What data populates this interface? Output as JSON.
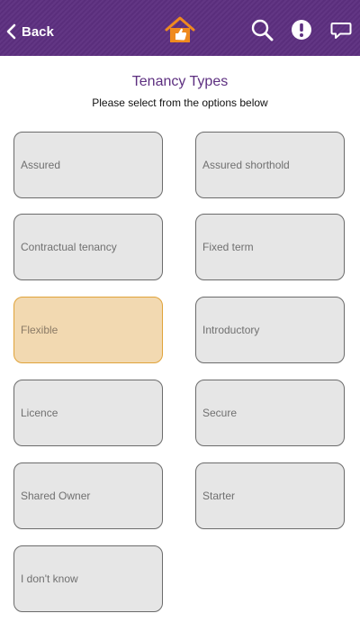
{
  "header": {
    "back_label": "Back",
    "accent_color": "#5d2f80",
    "home_icon_color": "#ef8a1f",
    "icons": [
      "chevron-left-icon",
      "house-thumbs-up-icon",
      "search-icon",
      "exclamation-icon",
      "speech-bubble-icon"
    ]
  },
  "page": {
    "title": "Tenancy Types",
    "subtitle": "Please select from the options below"
  },
  "options": [
    {
      "label": "Assured",
      "selected": false
    },
    {
      "label": "Assured shorthold",
      "selected": false
    },
    {
      "label": "Contractual tenancy",
      "selected": false
    },
    {
      "label": "Fixed term",
      "selected": false
    },
    {
      "label": "Flexible",
      "selected": true
    },
    {
      "label": "Introductory",
      "selected": false
    },
    {
      "label": "Licence",
      "selected": false
    },
    {
      "label": "Secure",
      "selected": false
    },
    {
      "label": "Shared Owner",
      "selected": false
    },
    {
      "label": "Starter",
      "selected": false
    },
    {
      "label": "I don't know",
      "selected": false
    }
  ]
}
